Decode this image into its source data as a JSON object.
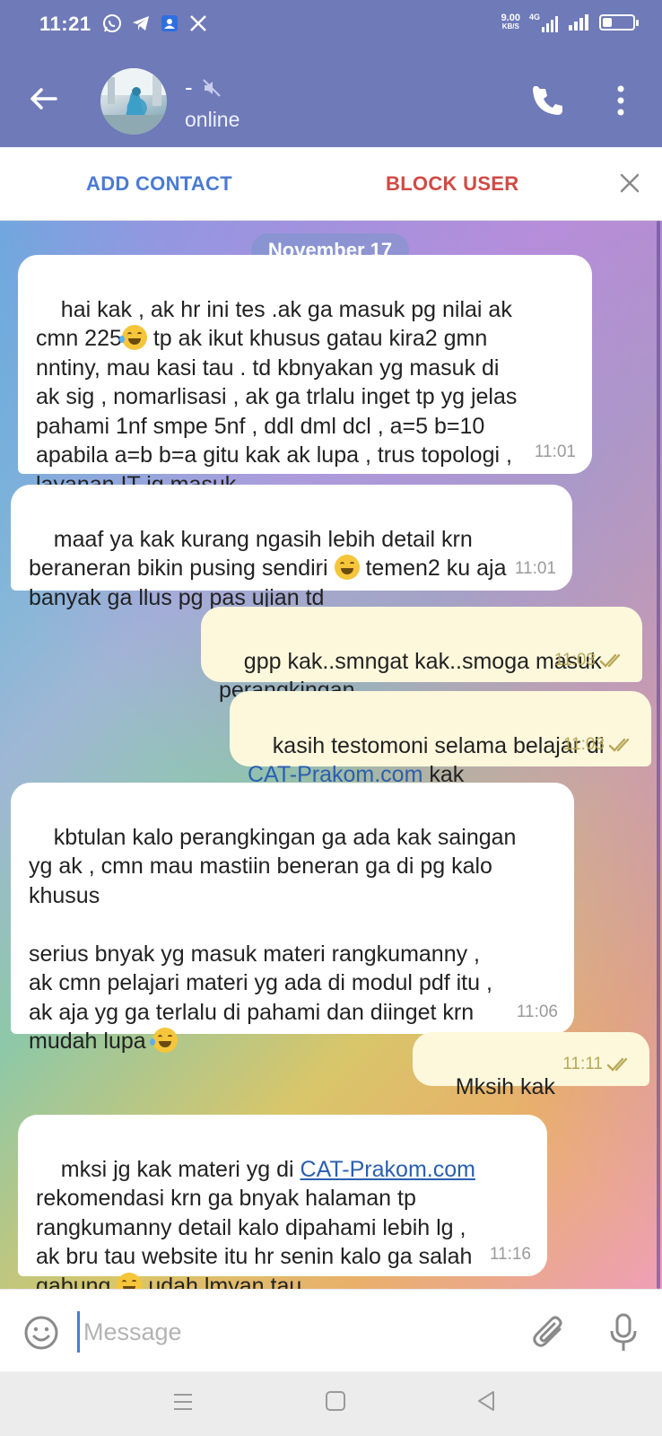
{
  "status_bar": {
    "time": "11:21",
    "net_speed_value": "9.00",
    "net_speed_unit": "KB/S",
    "network": "4G",
    "battery_level": 0.3,
    "app_icons": [
      "whatsapp-icon",
      "telegram-icon",
      "contacts-icon",
      "x-icon"
    ]
  },
  "header": {
    "contact_name": "-",
    "status": "online",
    "muted": true
  },
  "action_bar": {
    "add_contact": "ADD CONTACT",
    "block_user": "BLOCK USER"
  },
  "chat": {
    "date_chip": "November 17",
    "messages": [
      {
        "direction": "in",
        "text_before_emoji": "hai kak , ak hr ini tes .ak ga masuk pg nilai ak\ncmn 225",
        "text_after_emoji": " tp ak ikut khusus gatau kira2 gmn\nnntiny, mau kasi tau . td kbnyakan yg masuk di\nak sig , nomarlisasi , ak ga trlalu inget tp yg jelas\npahami 1nf smpe 5nf , ddl dml dcl , a=5 b=10\napabila a=b b=a gitu kak ak lupa , trus topologi ,\nlayanan IT jg masuk",
        "time": "11:01"
      },
      {
        "direction": "in",
        "text_before_emoji": "maaf ya kak kurang ngasih lebih detail krn\nberaneran bikin pusing sendiri ",
        "text_after_emoji": " temen2 ku aja\nbanyak ga llus pg pas ujian td",
        "time": "11:01"
      },
      {
        "direction": "out",
        "text": "gpp kak..smngat kak..smoga masuk\nperangkingan",
        "time": "11:03"
      },
      {
        "direction": "out",
        "text_before_link": "kasih testomoni selama belajar di\n",
        "link": "CAT-Prakom.com",
        "text_after_link": " kak",
        "time": "11:03"
      },
      {
        "direction": "in",
        "text_before_emoji": "kbtulan kalo perangkingan ga ada kak saingan\nyg ak , cmn mau mastiin beneran ga di pg kalo\nkhusus\n\nserius bnyak yg masuk materi rangkumanny ,\nak cmn pelajari materi yg ada di modul pdf itu ,\nak aja yg ga terlalu di pahami dan diinget krn\nmudah lupa ",
        "time": "11:06"
      },
      {
        "direction": "out",
        "text": "Mksih kak",
        "time": "11:11"
      },
      {
        "direction": "in",
        "text_before_link": "mksi jg kak materi yg di ",
        "link": "CAT-Prakom.com",
        "text_after_link": "\nrekomendasi krn ga bnyak halaman tp\nrangkumanny detail kalo dipahami lebih lg ,\nak bru tau website itu hr senin kalo ga salah\ngabung ",
        "text_after_emoji": " udah lmyan tau",
        "time": "11:16"
      }
    ]
  },
  "input_bar": {
    "placeholder": "Message"
  },
  "colors": {
    "header_bg": "#6f7ab8",
    "add_contact": "#4b7bd4",
    "block_user": "#d04a45",
    "outgoing_bubble": "#fdf8dc",
    "incoming_bubble": "#ffffff",
    "link": "#2a5fb0"
  }
}
